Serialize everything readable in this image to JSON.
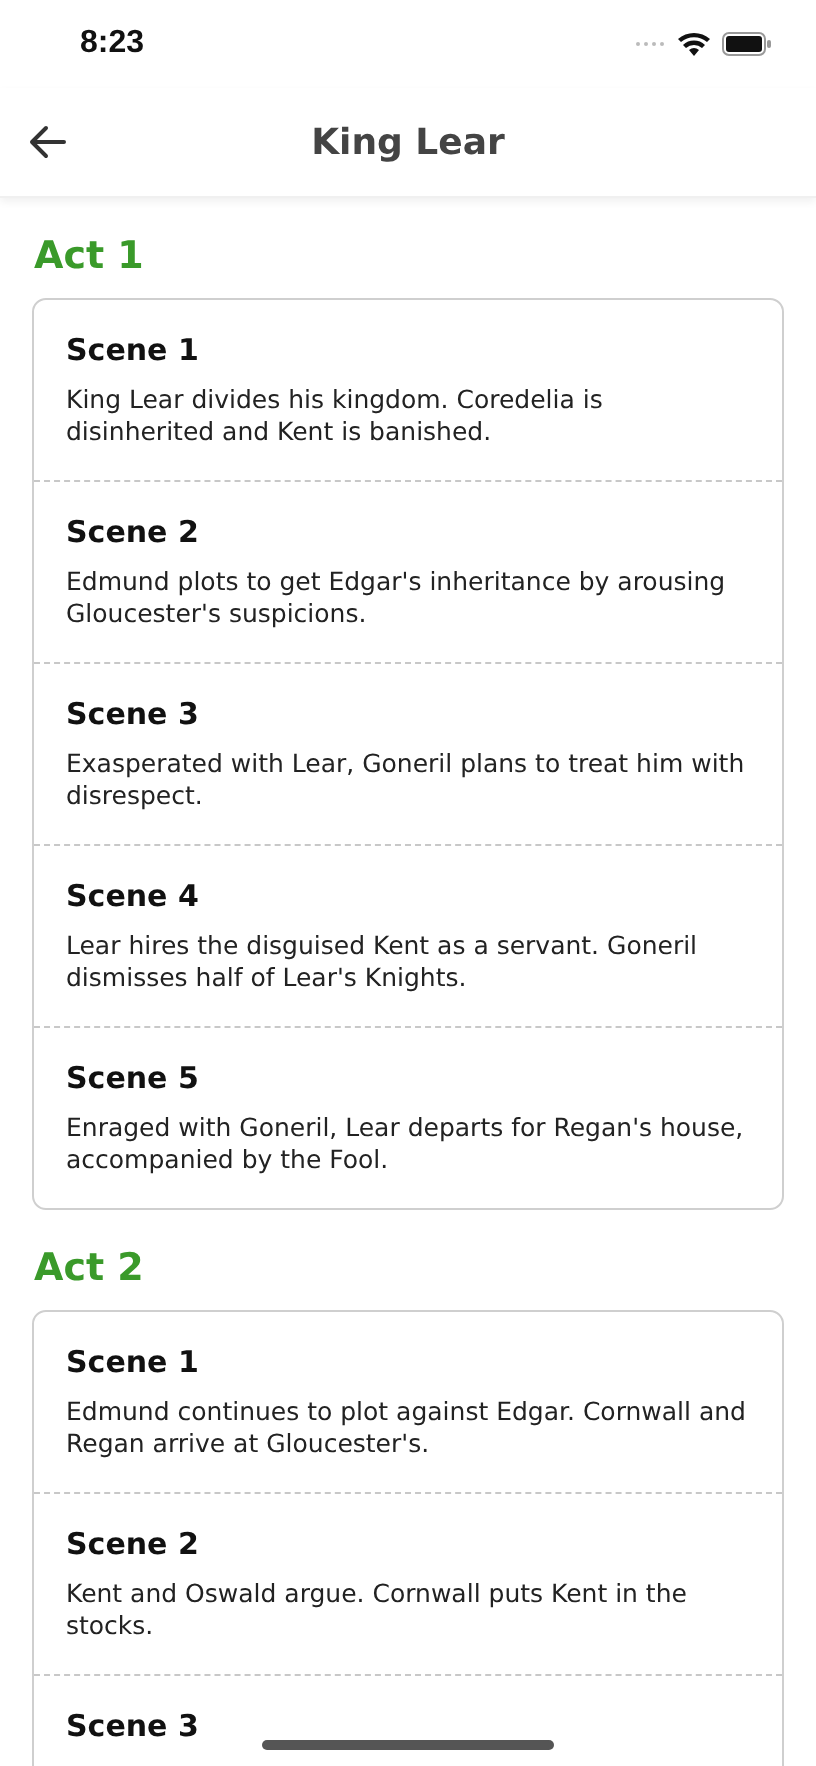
{
  "status_bar": {
    "time": "8:23"
  },
  "header": {
    "title": "King Lear"
  },
  "acts": [
    {
      "title": "Act 1",
      "scenes": [
        {
          "title": "Scene 1",
          "summary": "King Lear divides his kingdom. Coredelia is disinherited and Kent is banished."
        },
        {
          "title": "Scene 2",
          "summary": "Edmund plots to get Edgar's inheritance by arousing Gloucester's suspicions."
        },
        {
          "title": "Scene 3",
          "summary": "Exasperated with Lear, Goneril plans to treat him with disrespect."
        },
        {
          "title": "Scene 4",
          "summary": "Lear hires the disguised Kent as a servant. Goneril dismisses half of Lear's Knights."
        },
        {
          "title": "Scene 5",
          "summary": "Enraged with Goneril, Lear departs for Regan's house, accompanied by the Fool."
        }
      ]
    },
    {
      "title": "Act 2",
      "scenes": [
        {
          "title": "Scene 1",
          "summary": "Edmund continues to plot against Edgar. Cornwall and Regan arrive at Gloucester's."
        },
        {
          "title": "Scene 2",
          "summary": "Kent and Oswald argue. Cornwall puts Kent in the stocks."
        },
        {
          "title": "Scene 3"
        }
      ]
    }
  ]
}
